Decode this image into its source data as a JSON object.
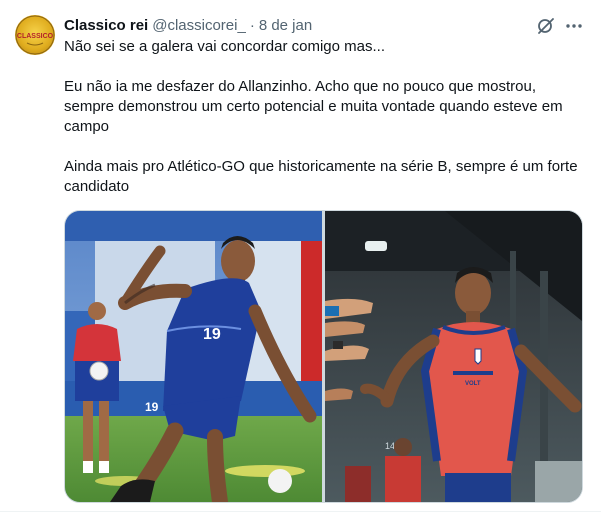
{
  "tweet": {
    "author_name": "Classico rei",
    "author_handle": "@classicorei_",
    "separator": "·",
    "date": "8 de jan",
    "avatar_text": "CLASSICO",
    "paragraphs": [
      "Não sei se a galera vai concordar comigo mas...",
      "Eu não ia me desfazer do Allanzinho. Acho que no pouco que mostrou, sempre demonstrou um certo potencial e muita vontade quando esteve em campo",
      "Ainda mais pro Atlético-GO que historicamente na série B, sempre é um forte candidato"
    ],
    "photo_left": {
      "jersey_number": "19",
      "shorts_number": "19"
    },
    "photo_right": {
      "background_sign": "1445",
      "shirt_text": "VOLT"
    }
  },
  "icons": {
    "grok": "grok-icon",
    "more": "more-icon"
  },
  "colors": {
    "text": "#0f1419",
    "secondary": "#536471",
    "border": "#cfd9de",
    "jersey_blue": "#1f3f9c",
    "shirt_red": "#e2574c"
  }
}
